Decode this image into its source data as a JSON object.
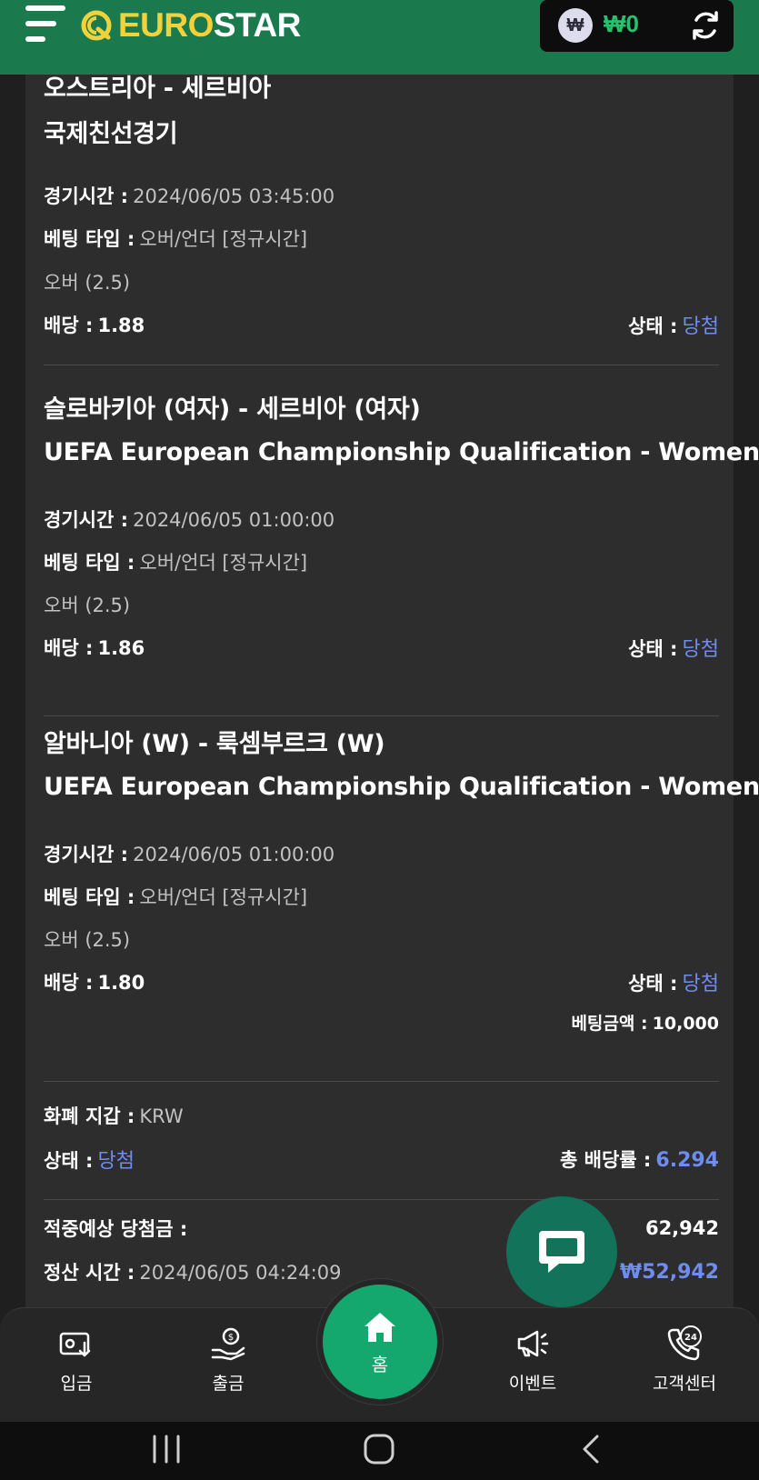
{
  "header": {
    "logo_euro": "EURO",
    "logo_star": "STAR",
    "currency_symbol": "₩",
    "balance": "₩0"
  },
  "bets": [
    {
      "match": "오스트리아 - 세르비아",
      "league": "국제친선경기",
      "time_label": "경기시간 :",
      "time": "2024/06/05 03:45:00",
      "type_label": "베팅 타입 :",
      "type": "오버/언더 [정규시간]",
      "pick": "오버 (2.5)",
      "odds_label": "배당 :",
      "odds": "1.88",
      "status_label": "상태 :",
      "status": "당첨"
    },
    {
      "match": "슬로바키아 (여자) - 세르비아 (여자)",
      "league": "UEFA European Championship Qualification - Women",
      "time_label": "경기시간 :",
      "time": "2024/06/05 01:00:00",
      "type_label": "베팅 타입 :",
      "type": "오버/언더 [정규시간]",
      "pick": "오버 (2.5)",
      "odds_label": "배당 :",
      "odds": "1.86",
      "status_label": "상태 :",
      "status": "당첨"
    },
    {
      "match": "알바니아 (W) - 룩셈부르크 (W)",
      "league": "UEFA European Championship Qualification - Women",
      "time_label": "경기시간 :",
      "time": "2024/06/05 01:00:00",
      "type_label": "베팅 타입 :",
      "type": "오버/언더 [정규시간]",
      "pick": "오버 (2.5)",
      "odds_label": "배당 :",
      "odds": "1.80",
      "status_label": "상태 :",
      "status": "당첨"
    }
  ],
  "summary": {
    "stake_label": "베팅금액 :",
    "stake": "10,000",
    "wallet_label": "화폐 지갑 :",
    "wallet": "KRW",
    "status_label": "상태 :",
    "status": "당첨",
    "total_odds_label": "총 배당률 :",
    "total_odds": "6.294",
    "expected_win_label": "적중예상 당첨금 :",
    "expected_win": "62,942",
    "settle_label": "정산 시간 :",
    "settle_time": "2024/06/05 04:24:09",
    "profit": "₩52,942"
  },
  "nav": {
    "deposit": "입금",
    "withdraw": "출금",
    "home": "홈",
    "events": "이벤트",
    "support": "고객센터",
    "support_badge": "24"
  },
  "colors": {
    "header_green": "#1a7a4e",
    "logo_yellow": "#f2d23b",
    "win_blue": "#6f8df0",
    "home_green": "#14a86e",
    "chat_green": "#12725a"
  }
}
